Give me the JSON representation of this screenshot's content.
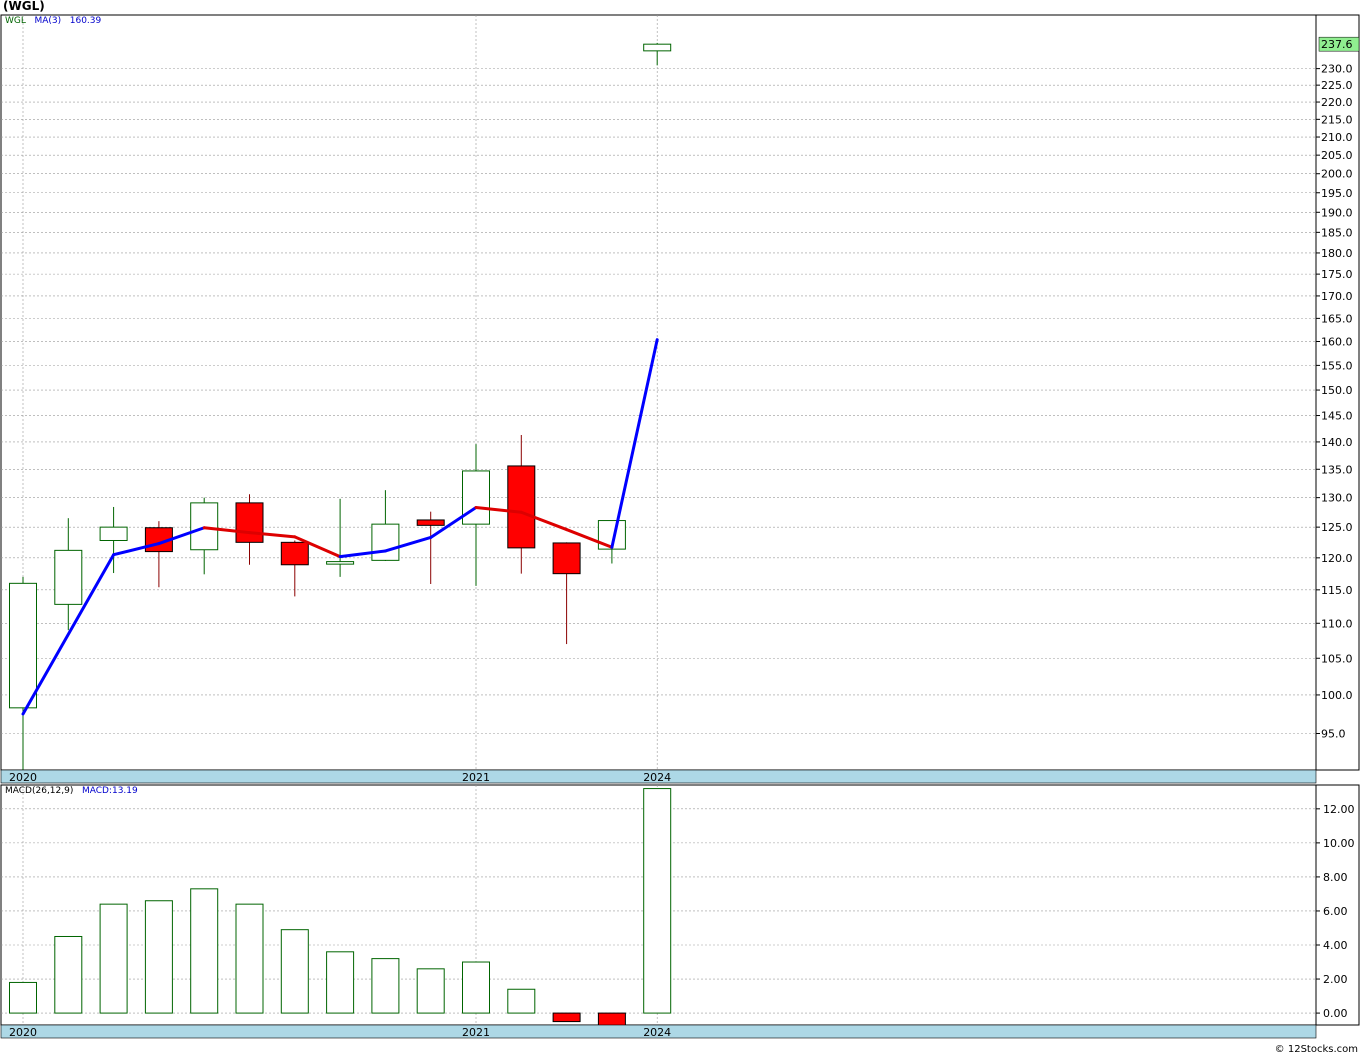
{
  "title": "(WGL)",
  "footer": "© 12Stocks.com",
  "colors": {
    "up_border": "#006400",
    "down_fill": "#ff0000",
    "ma_up": "#0000ff",
    "ma_down": "#dd0000",
    "axis_band": "#add8e6",
    "last_price_bg": "#90ee90",
    "grid": "#999999"
  },
  "chart_data": [
    {
      "type": "candlestick",
      "legend": {
        "symbol": "WGL",
        "ma_label": "MA(3)",
        "ma_value": "160.39"
      },
      "x_labels": [
        {
          "index": 0,
          "label": "2020"
        },
        {
          "index": 10,
          "label": "2021"
        },
        {
          "index": 14,
          "label": "2024"
        }
      ],
      "y_ticks": [
        95.0,
        100.0,
        105.0,
        110.0,
        115.0,
        120.0,
        125.0,
        130.0,
        135.0,
        140.0,
        145.0,
        150.0,
        155.0,
        160.0,
        165.0,
        170.0,
        175.0,
        180.0,
        185.0,
        190.0,
        195.0,
        200.0,
        205.0,
        210.0,
        215.0,
        220.0,
        225.0,
        230.0
      ],
      "y_scale": "log",
      "ylim": [
        90.5,
        247
      ],
      "last_price": "237.6",
      "grid": true,
      "ohlc": [
        {
          "o": 98.3,
          "h": 117.0,
          "l": 90.5,
          "c": 116.0
        },
        {
          "o": 112.8,
          "h": 126.5,
          "l": 109.0,
          "c": 121.2
        },
        {
          "o": 122.8,
          "h": 128.4,
          "l": 117.6,
          "c": 125.0
        },
        {
          "o": 124.9,
          "h": 126.0,
          "l": 115.4,
          "c": 121.0
        },
        {
          "o": 121.3,
          "h": 130.0,
          "l": 117.4,
          "c": 129.1
        },
        {
          "o": 129.1,
          "h": 130.6,
          "l": 118.9,
          "c": 122.5
        },
        {
          "o": 122.5,
          "h": 122.8,
          "l": 114.0,
          "c": 118.9
        },
        {
          "o": 119.0,
          "h": 129.8,
          "l": 117.0,
          "c": 119.4
        },
        {
          "o": 119.6,
          "h": 131.3,
          "l": 119.5,
          "c": 125.5
        },
        {
          "o": 126.2,
          "h": 127.6,
          "l": 115.9,
          "c": 125.3
        },
        {
          "o": 125.5,
          "h": 139.6,
          "l": 115.6,
          "c": 134.7
        },
        {
          "o": 135.6,
          "h": 141.3,
          "l": 117.5,
          "c": 121.6
        },
        {
          "o": 122.4,
          "h": 122.5,
          "l": 107.0,
          "c": 117.5
        },
        {
          "o": 121.4,
          "h": 126.1,
          "l": 119.1,
          "c": 126.1
        },
        {
          "o": 235.5,
          "h": 238.0,
          "l": 231.0,
          "c": 237.6
        }
      ],
      "ma": [
        97.5,
        null,
        120.5,
        122.3,
        124.9,
        124.1,
        123.4,
        120.2,
        121.1,
        123.3,
        128.3,
        127.5,
        124.6,
        121.7,
        160.39
      ]
    },
    {
      "type": "bar",
      "legend": {
        "name": "MACD(26,12,9)",
        "value_label": "MACD:13.19"
      },
      "x_labels": [
        {
          "index": 0,
          "label": "2020"
        },
        {
          "index": 10,
          "label": "2021"
        },
        {
          "index": 14,
          "label": "2024"
        }
      ],
      "y_ticks": [
        0.0,
        2.0,
        4.0,
        6.0,
        8.0,
        10.0,
        12.0
      ],
      "ylim": [
        -0.7,
        13.4
      ],
      "grid": true,
      "values": [
        1.8,
        4.5,
        6.4,
        6.6,
        7.3,
        6.4,
        4.9,
        3.6,
        3.2,
        2.6,
        3.0,
        1.4,
        -0.5,
        -0.8,
        13.19
      ]
    }
  ]
}
